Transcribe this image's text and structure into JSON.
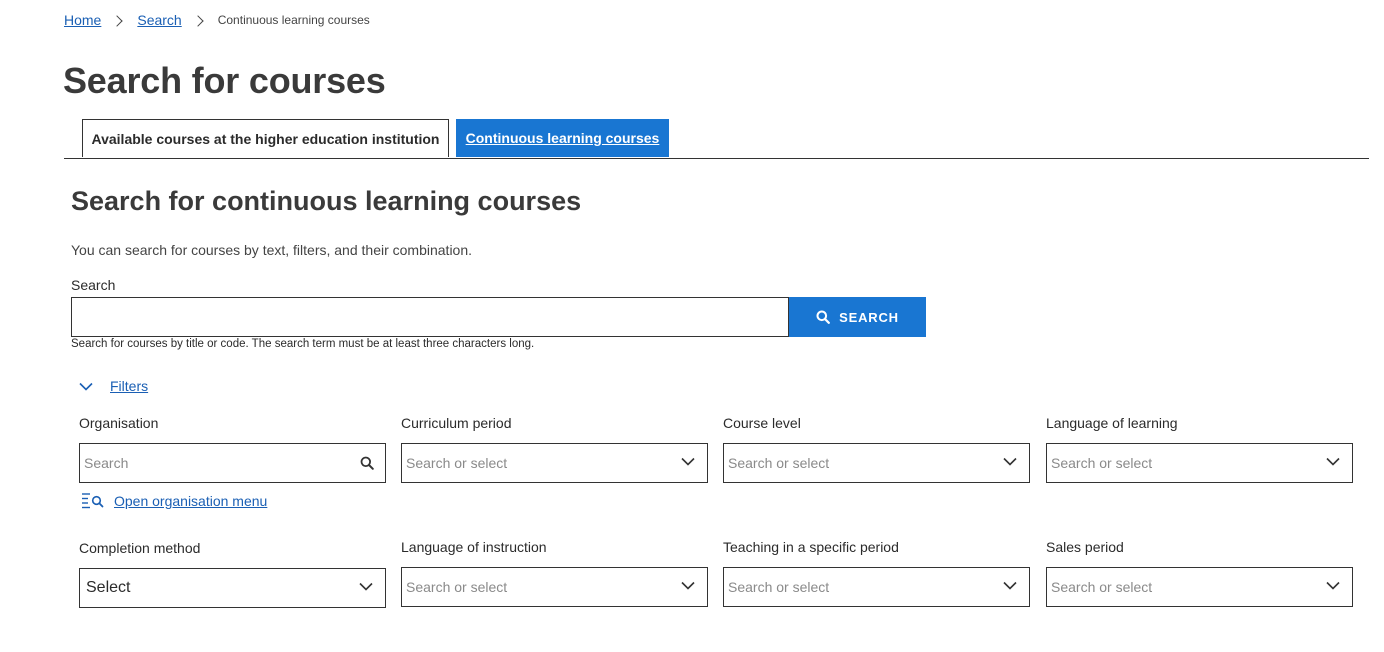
{
  "breadcrumb": {
    "home": "Home",
    "search": "Search",
    "current": "Continuous learning courses"
  },
  "page": {
    "title": "Search for courses"
  },
  "tabs": [
    {
      "label": "Available courses at the higher education institution",
      "active": false
    },
    {
      "label": "Continuous learning courses",
      "active": true
    }
  ],
  "section": {
    "title": "Search for continuous learning courses",
    "intro": "You can search for courses by text, filters, and their combination."
  },
  "search": {
    "label": "Search",
    "value": "",
    "button_label": "SEARCH",
    "button_icon": "search-icon",
    "help": "Search for courses by title or code. The search term must be at least three characters long."
  },
  "filters": {
    "toggle_label": "Filters",
    "toggle_icon": "chevron-down-icon",
    "organisation": {
      "label": "Organisation",
      "placeholder": "Search",
      "icon": "search-icon"
    },
    "open_org_menu": {
      "label": "Open organisation menu",
      "icon": "list-search-icon"
    },
    "curriculum_period": {
      "label": "Curriculum period",
      "placeholder": "Search or select"
    },
    "course_level": {
      "label": "Course level",
      "placeholder": "Search or select"
    },
    "language_of_learning": {
      "label": "Language of learning",
      "placeholder": "Search or select"
    },
    "completion_method": {
      "label": "Completion method",
      "value": "Select"
    },
    "language_of_instruction": {
      "label": "Language of instruction",
      "placeholder": "Search or select"
    },
    "teaching_period": {
      "label": "Teaching in a specific period",
      "placeholder": "Search or select"
    },
    "sales_period": {
      "label": "Sales period",
      "placeholder": "Search or select"
    }
  },
  "colors": {
    "accent": "#1976d2",
    "link": "#1a5fb4",
    "text": "#2b2b2b"
  }
}
